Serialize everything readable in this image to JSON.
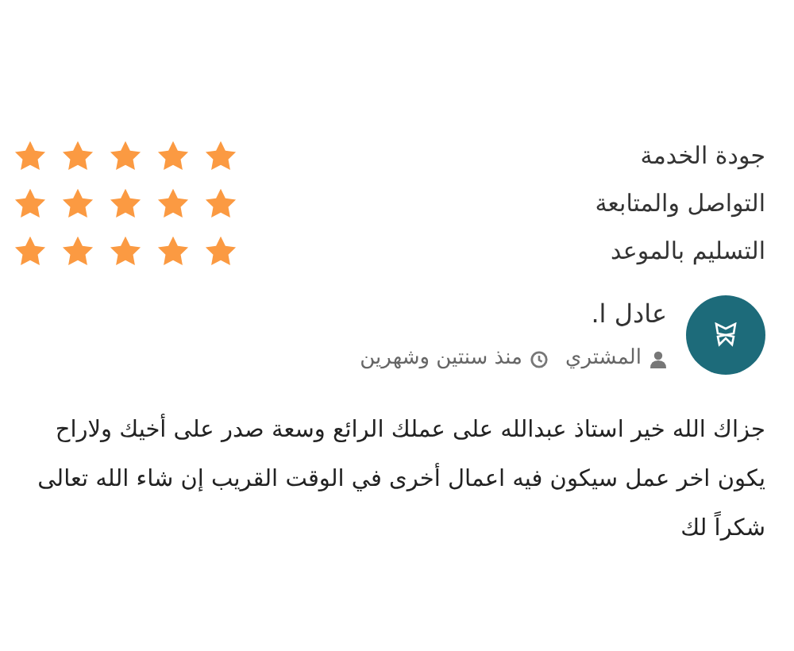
{
  "ratings": [
    {
      "label": "جودة الخدمة",
      "stars": 5
    },
    {
      "label": "التواصل والمتابعة",
      "stars": 5
    },
    {
      "label": "التسليم بالموعد",
      "stars": 5
    }
  ],
  "review": {
    "author": "عادل ا.",
    "role": "المشتري",
    "time": "منذ سنتين وشهرين",
    "text": "جزاك الله خير استاذ عبدالله على عملك الرائع وسعة صدر على أخيك ولاراح يكون اخر عمل سيكون فيه اعمال أخرى في الوقت القريب إن شاء الله تعالى شكراً لك"
  }
}
